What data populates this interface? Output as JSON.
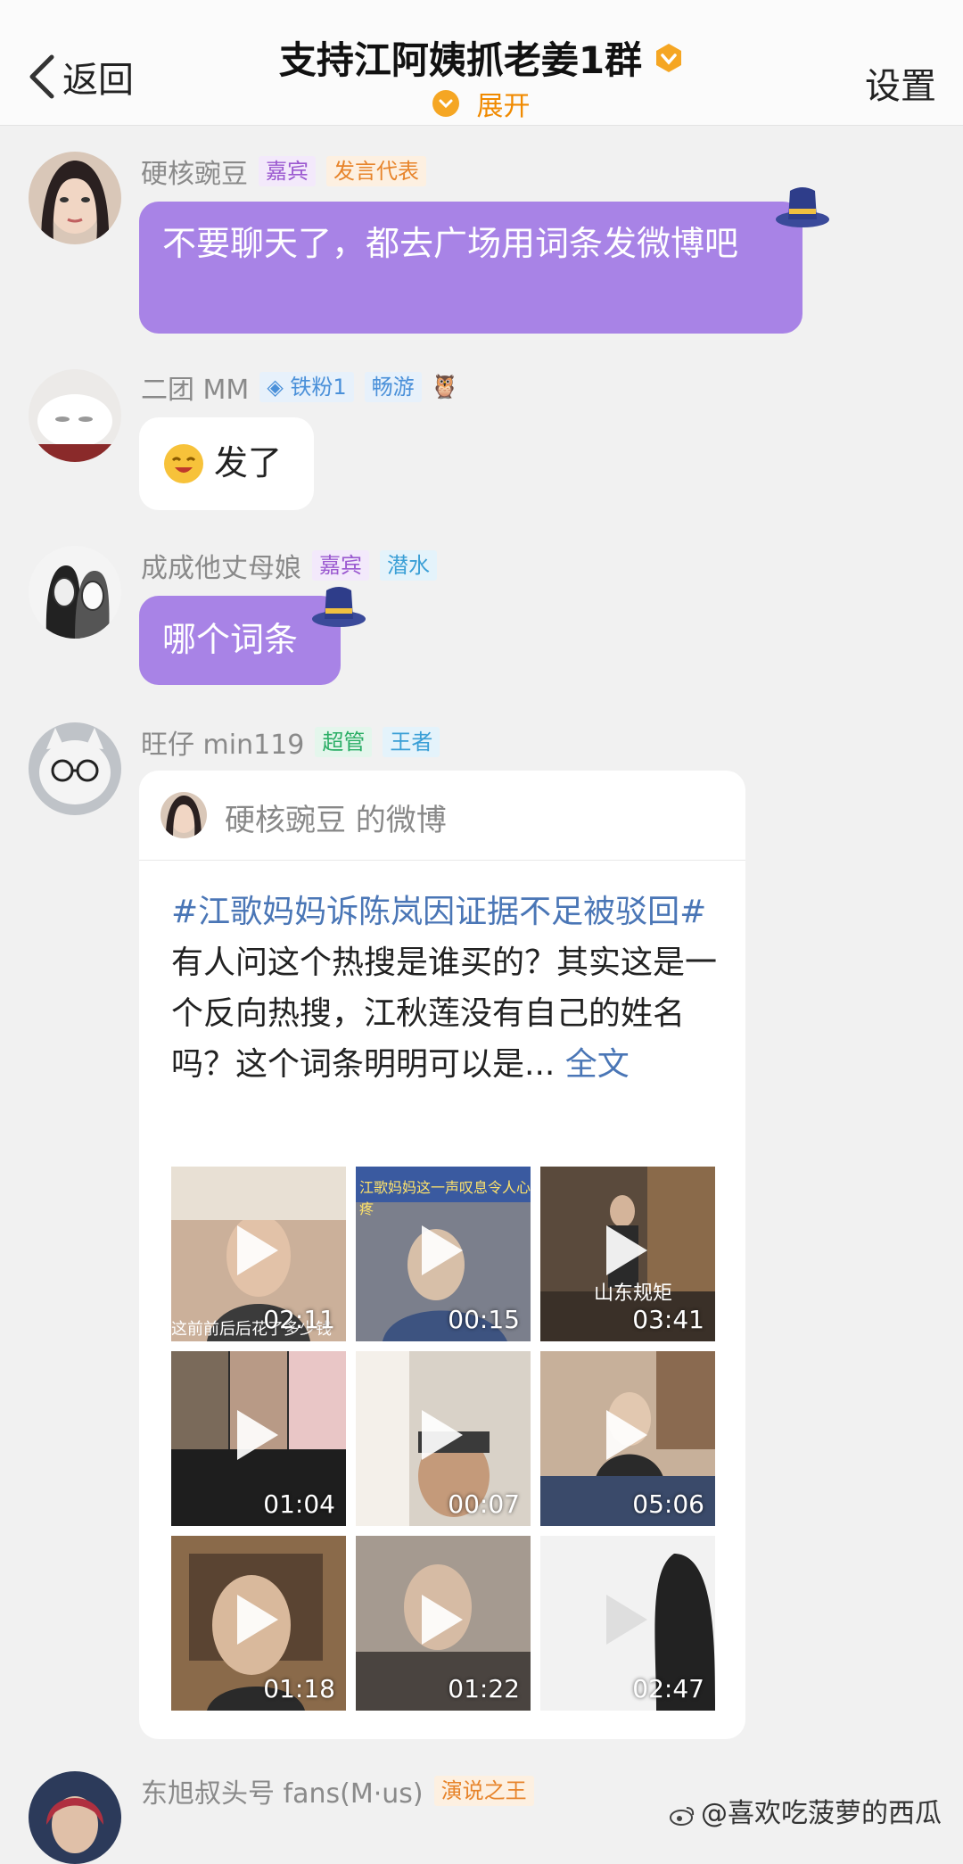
{
  "header": {
    "back_label": "返回",
    "title": "支持江阿姨抓老姜1群",
    "expand_label": "展开",
    "settings_label": "设置"
  },
  "messages": [
    {
      "username": "硬核豌豆",
      "tags": [
        "嘉宾",
        "发言代表"
      ],
      "text": "不要聊天了，都去广场用词条发微博吧"
    },
    {
      "username": "二团 MM",
      "tags": [
        "铁粉1",
        "畅游"
      ],
      "text": "发了"
    },
    {
      "username": "成成他丈母娘",
      "tags": [
        "嘉宾",
        "潜水"
      ],
      "text": "哪个词条"
    },
    {
      "username": "旺仔 min119",
      "tags": [
        "超管",
        "王者"
      ]
    },
    {
      "username": "东旭叔头号 fans(M·us)",
      "tags": [
        "演说之王"
      ]
    }
  ],
  "weibo_card": {
    "title": "硬核豌豆 的微博",
    "hashtag": "#江歌妈妈诉陈岚因证据不足被驳回#",
    "body": " 有人问这个热搜是谁买的？其实这是一个反向热搜，江秋莲没有自己的姓名吗？这个词条明明可以是...",
    "more_label": "全文",
    "videos": [
      {
        "duration": "02:11",
        "caption": "这前前后后花了多少钱"
      },
      {
        "duration": "00:15",
        "caption": "江歌妈妈这一声叹息令人心疼"
      },
      {
        "duration": "03:41",
        "caption": "山东规矩"
      },
      {
        "duration": "01:04",
        "caption": ""
      },
      {
        "duration": "00:07",
        "caption": ""
      },
      {
        "duration": "05:06",
        "caption": ""
      },
      {
        "duration": "01:18",
        "caption": ""
      },
      {
        "duration": "01:22",
        "caption": ""
      },
      {
        "duration": "02:47",
        "caption": ""
      }
    ]
  },
  "watermark": "@喜欢吃菠萝的西瓜",
  "colors": {
    "accent_orange": "#f5a623",
    "bubble_purple": "#a883e6",
    "link_blue": "#4a76b6"
  }
}
